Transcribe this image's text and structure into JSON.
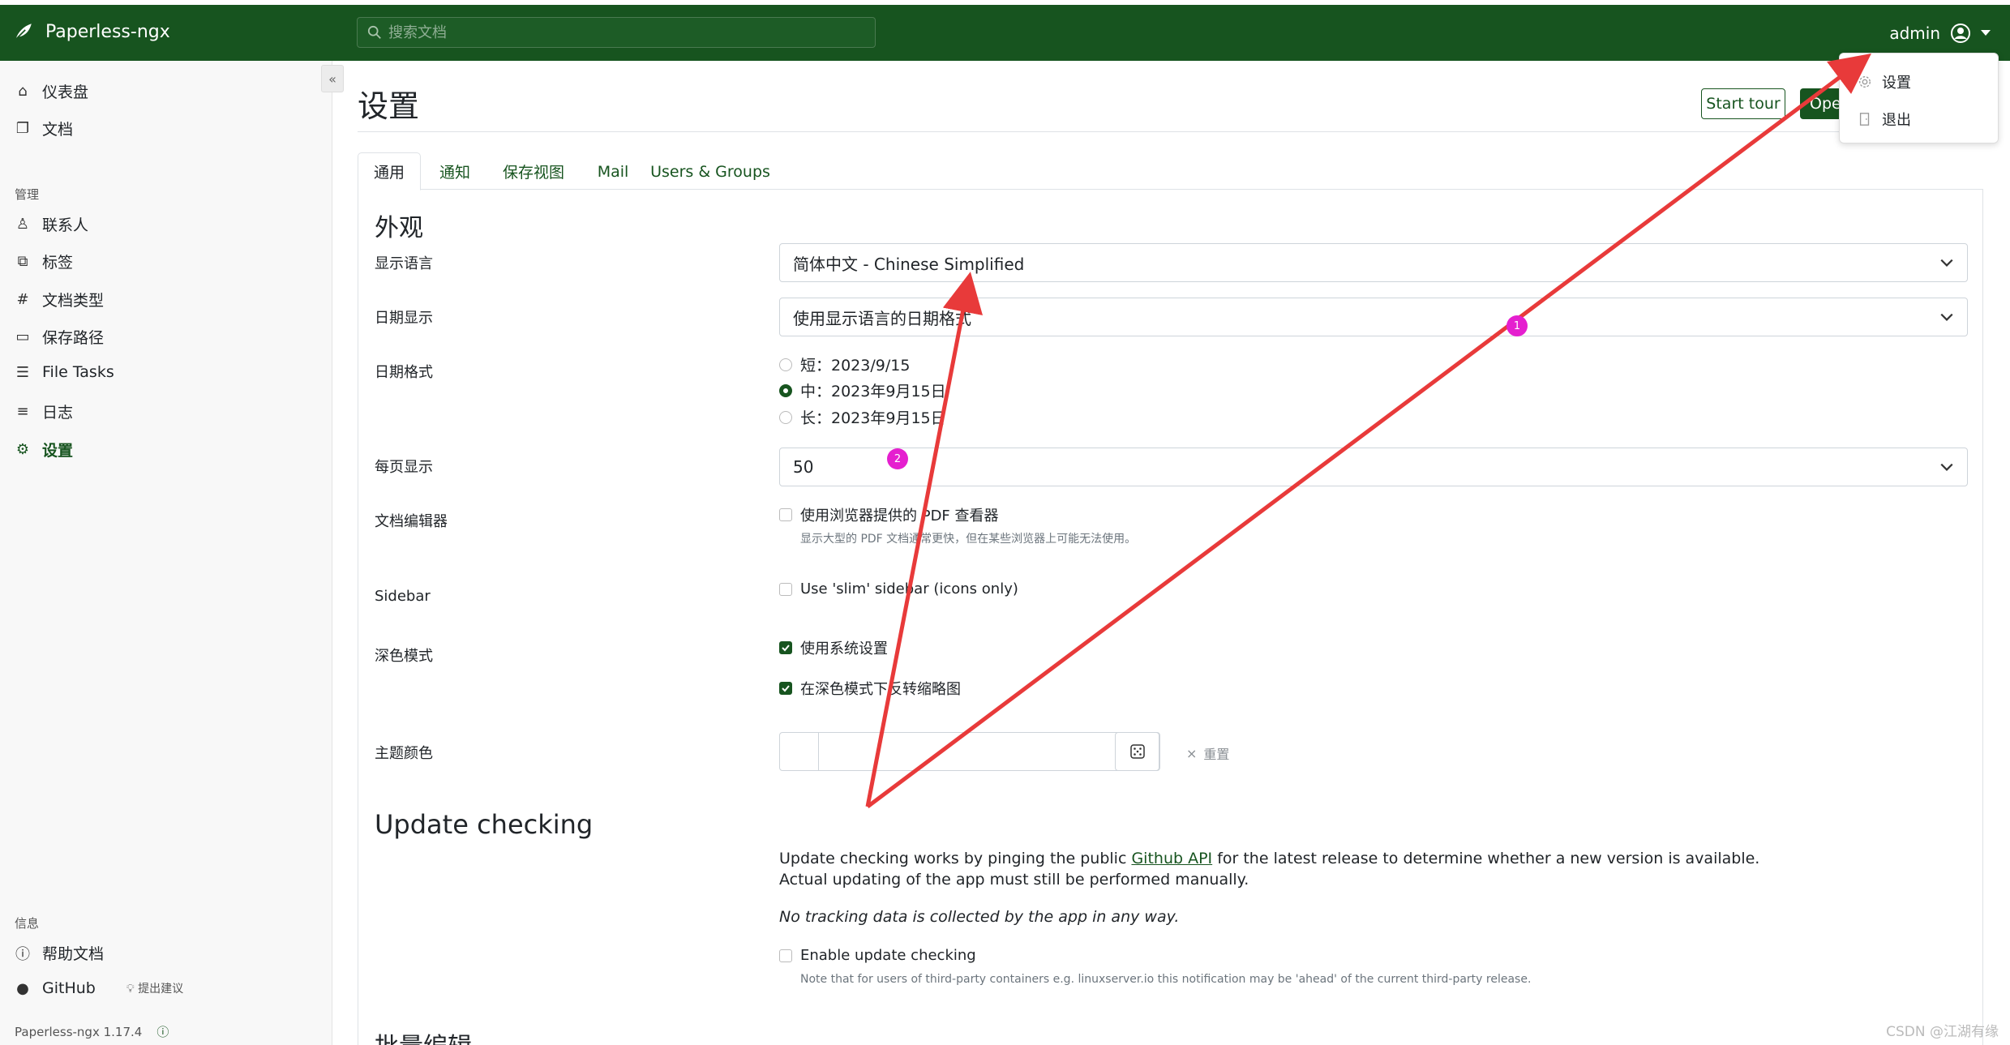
{
  "app": {
    "name": "Paperless-ngx",
    "version": "Paperless-ngx 1.17.4"
  },
  "search": {
    "placeholder": "搜索文档"
  },
  "user": {
    "name": "admin"
  },
  "dropdown": {
    "settings": "设置",
    "logout": "退出"
  },
  "sidebar": {
    "top_items": [
      {
        "label": "仪表盘",
        "icon": "house-icon"
      },
      {
        "label": "文档",
        "icon": "documents-icon"
      }
    ],
    "manage_heading": "管理",
    "manage_items": [
      {
        "label": "联系人",
        "icon": "person-icon"
      },
      {
        "label": "标签",
        "icon": "tags-icon"
      },
      {
        "label": "文档类型",
        "icon": "hash-icon"
      },
      {
        "label": "保存路径",
        "icon": "folder-icon"
      },
      {
        "label": "File Tasks",
        "icon": "list-task-icon"
      },
      {
        "label": "日志",
        "icon": "text-icon"
      },
      {
        "label": "设置",
        "icon": "gear-icon"
      }
    ],
    "info_heading": "信息",
    "info_items": [
      {
        "label": "帮助文档",
        "icon": "question-icon"
      },
      {
        "label": "GitHub",
        "icon": "github-icon"
      }
    ],
    "suggest": "提出建议"
  },
  "page": {
    "title": "设置",
    "start_tour": "Start tour",
    "open_btn": "Ope",
    "tabs": [
      "通用",
      "通知",
      "保存视图",
      "Mail",
      "Users & Groups"
    ]
  },
  "appearance": {
    "heading": "外观",
    "display_language_label": "显示语言",
    "display_language_value": "简体中文 - Chinese Simplified",
    "date_display_label": "日期显示",
    "date_display_value": "使用显示语言的日期格式",
    "date_format_label": "日期格式",
    "date_formats": [
      {
        "text": "短：2023/9/15",
        "selected": false
      },
      {
        "text": "中：2023年9月15日",
        "selected": true
      },
      {
        "text": "长：2023年9月15日",
        "selected": false
      }
    ],
    "per_page_label": "每页显示",
    "per_page_value": "50",
    "doc_editor_label": "文档编辑器",
    "doc_editor_option": "使用浏览器提供的 PDF 查看器",
    "doc_editor_hint": "显示大型的 PDF 文档通常更快，但在某些浏览器上可能无法使用。",
    "sidebar_label": "Sidebar",
    "sidebar_option": "Use 'slim' sidebar (icons only)",
    "dark_mode_label": "深色模式",
    "dark_mode_system": "使用系统设置",
    "dark_mode_invert": "在深色模式下反转缩略图",
    "theme_color_label": "主题颜色",
    "theme_reset": "重置"
  },
  "update": {
    "heading": "Update checking",
    "para1_pre": "Update checking works by pinging the public ",
    "para1_link": "Github API",
    "para1_post": " for the latest release to determine whether a new version is available.",
    "para2": "Actual updating of the app must still be performed manually.",
    "para3": "No tracking data is collected by the app in any way.",
    "enable_label": "Enable update checking",
    "enable_hint": "Note that for users of third-party containers e.g. linuxserver.io this notification may be 'ahead' of the current third-party release."
  },
  "bulk": {
    "heading": "批量编辑"
  },
  "annotations": {
    "badge1": "1",
    "badge2": "2",
    "arrow_color": "#e83a3a",
    "badge_color": "#e51fcf"
  },
  "watermark": "CSDN @江湖有缘"
}
